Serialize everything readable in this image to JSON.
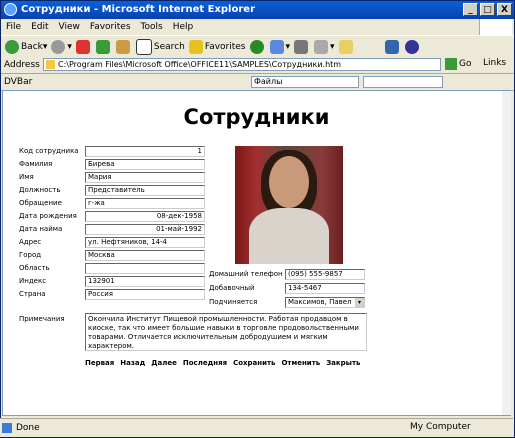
{
  "window": {
    "title": "Сотрудники - Microsoft Internet Explorer",
    "min": "_",
    "max": "□",
    "close": "X"
  },
  "menu": [
    "File",
    "Edit",
    "View",
    "Favorites",
    "Tools",
    "Help"
  ],
  "toolbar": {
    "back": "Back",
    "search": "Search",
    "favorites": "Favorites"
  },
  "address": {
    "label": "Address",
    "value": "C:\\Program Files\\Microsoft Office\\OFFICE11\\SAMPLES\\Сотрудники.htm",
    "go": "Go",
    "links": "Links"
  },
  "devbar": {
    "label": "DVBar",
    "dd1": "Файлы"
  },
  "page": {
    "heading": "Сотрудники",
    "fields": [
      {
        "label": "Код сотрудника",
        "value": "1"
      },
      {
        "label": "Фамилия",
        "value": "Бирева"
      },
      {
        "label": "Имя",
        "value": "Мария"
      },
      {
        "label": "Должность",
        "value": "Представитель"
      },
      {
        "label": "Обращение",
        "value": "г-жа"
      },
      {
        "label": "Дата рождения",
        "value": "08-дек-1958"
      },
      {
        "label": "Дата найма",
        "value": "01-май-1992"
      },
      {
        "label": "Адрес",
        "value": "ул. Нефтяников, 14-4"
      },
      {
        "label": "Город",
        "value": "Москва"
      },
      {
        "label": "Область",
        "value": ""
      },
      {
        "label": "Индекс",
        "value": "132901"
      },
      {
        "label": "Страна",
        "value": "Россия"
      },
      {
        "label": "Примечания",
        "value": ""
      }
    ],
    "right": [
      {
        "label": "Домашний телефон",
        "value": "(095) 555-9857"
      },
      {
        "label": "Добавочный",
        "value": "134-5467"
      },
      {
        "label": "Подчиняется",
        "value": "Максимов, Павел"
      }
    ],
    "notes": "Окончила Институт Пищевой промышленности. Работая продавцом в киоске, так что имеет большие навыки в торговле продовольственными товарами. Отличается исключительным добродушием и мягким характером.",
    "nav": [
      "Первая",
      "Назад",
      "Далее",
      "Последняя",
      "Сохранить",
      "Отменить",
      "Закрыть"
    ]
  },
  "status": {
    "left": "Done",
    "right": "My Computer"
  }
}
